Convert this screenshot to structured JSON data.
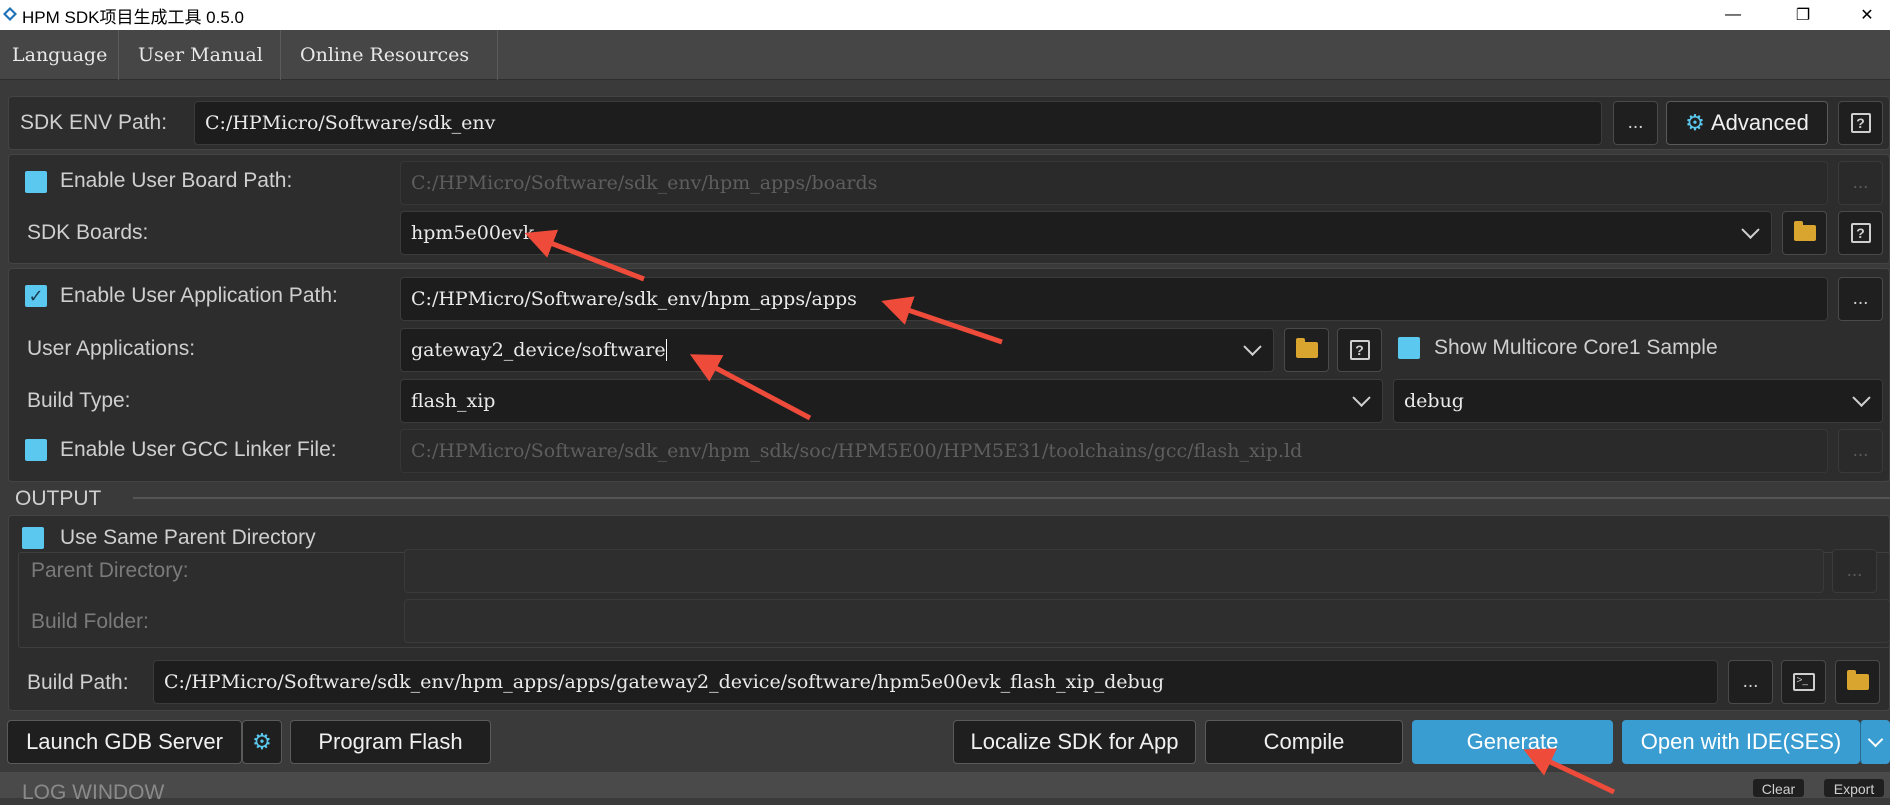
{
  "window": {
    "title": "HPM SDK项目生成工具 0.5.0",
    "minimize_icon": "—",
    "restore_icon": "❐",
    "close_icon": "✕"
  },
  "menu": [
    "Language",
    "User Manual",
    "Online Resources"
  ],
  "sdk_env": {
    "label": "SDK ENV Path:",
    "value": "C:/HPMicro/Software/sdk_env",
    "browse": "...",
    "advanced": "Advanced",
    "help": "?"
  },
  "board": {
    "enable_label": "Enable User Board Path:",
    "enable_checked": false,
    "path_value": "C:/HPMicro/Software/sdk_env/hpm_apps/boards",
    "browse": "...",
    "boards_label": "SDK Boards:",
    "boards_value": "hpm5e00evk",
    "help": "?"
  },
  "application": {
    "enable_label": "Enable User Application Path:",
    "enable_checked": true,
    "check_mark": "✓",
    "path_value": "C:/HPMicro/Software/sdk_env/hpm_apps/apps",
    "browse": "...",
    "apps_label": "User Applications:",
    "apps_value": "gateway2_device/software",
    "help": "?",
    "multicore_label": "Show Multicore Core1 Sample",
    "multicore_checked": false,
    "build_type_label": "Build Type:",
    "build_type_value": "flash_xip",
    "build_mode_value": "debug",
    "linker_label": "Enable User GCC Linker File:",
    "linker_checked": false,
    "linker_value": "C:/HPMicro/Software/sdk_env/hpm_sdk/soc/HPM5E00/HPM5E31/toolchains/gcc/flash_xip.ld",
    "linker_browse": "..."
  },
  "output": {
    "section_label": "OUTPUT",
    "same_parent_label": "Use Same Parent Directory",
    "same_parent_checked": false,
    "parent_dir_label": "Parent Directory:",
    "parent_dir_browse": "...",
    "build_folder_label": "Build Folder:",
    "build_path_label": "Build Path:",
    "build_path_value": "C:/HPMicro/Software/sdk_env/hpm_apps/apps/gateway2_device/software/hpm5e00evk_flash_xip_debug",
    "build_path_browse": "..."
  },
  "actions": {
    "launch_gdb": "Launch GDB Server",
    "program_flash": "Program Flash",
    "localize": "Localize SDK for App",
    "compile": "Compile",
    "generate": "Generate",
    "open_ide": "Open with IDE(SES)"
  },
  "log": {
    "title": "LOG WINDOW",
    "clear": "Clear",
    "export": "Export"
  },
  "colors": {
    "accent": "#3a9dd1",
    "checkbox": "#5bc8ef",
    "arrow": "#ee4b3a",
    "folder": "#d9a52e"
  }
}
